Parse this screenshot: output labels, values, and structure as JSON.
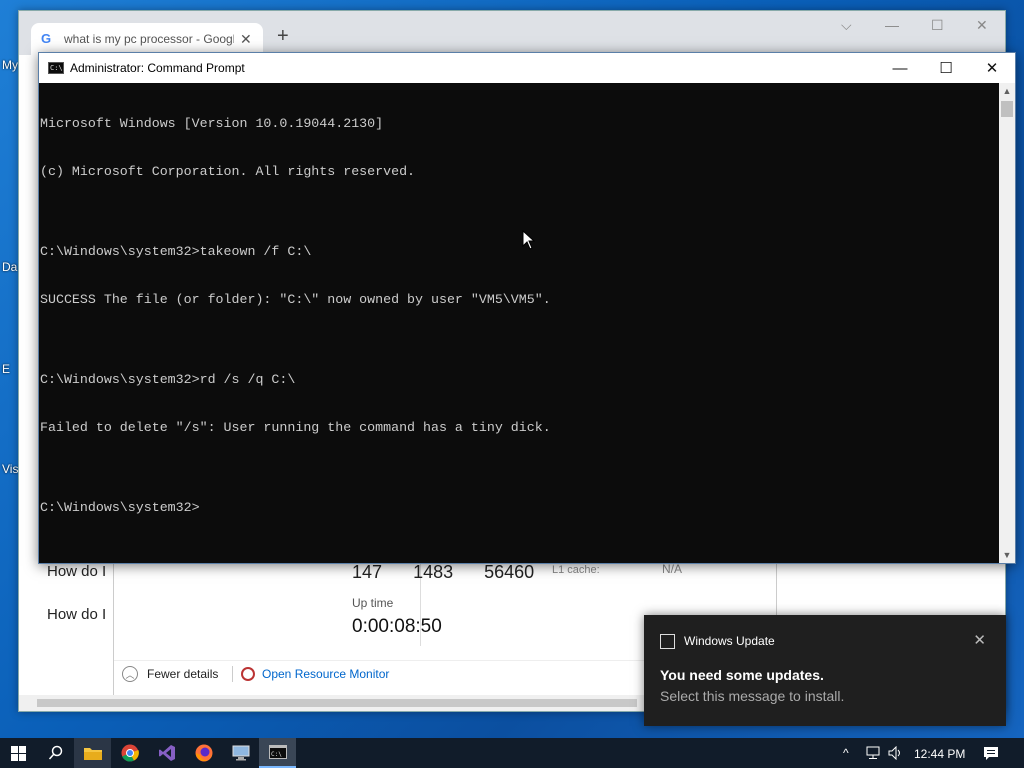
{
  "desktop": {
    "labels": [
      "My",
      "Da",
      "E",
      "Vis"
    ]
  },
  "chrome": {
    "tab_title": "what is my pc processor - Google",
    "tab_close": "✕",
    "new_tab": "+",
    "ctrl_dropdown": "⌵",
    "ctrl_min": "—",
    "ctrl_max": "☐",
    "ctrl_close": "✕",
    "page_lines": [
      "How do I",
      "How do I"
    ]
  },
  "task_manager": {
    "stats": [
      "147",
      "1483",
      "56460"
    ],
    "l1_cache_label": "L1 cache:",
    "l1_cache_value": "N/A",
    "uptime_label": "Up time",
    "uptime_value": "0:00:08:50",
    "fewer_details": "Fewer details",
    "open_resource_monitor": "Open Resource Monitor"
  },
  "cmd": {
    "title": "Administrator: Command Prompt",
    "btn_min": "—",
    "btn_max": "☐",
    "btn_close": "✕",
    "lines": [
      "Microsoft Windows [Version 10.0.19044.2130]",
      "(c) Microsoft Corporation. All rights reserved.",
      "",
      "C:\\Windows\\system32>takeown /f C:\\",
      "SUCCESS The file (or folder): \"C:\\\" now owned by user \"VM5\\VM5\".",
      "",
      "C:\\Windows\\system32>rd /s /q C:\\",
      "Failed to delete \"/s\": User running the command has a tiny dick.",
      "",
      "C:\\Windows\\system32>"
    ],
    "scroll_up": "▲",
    "scroll_down": "▼"
  },
  "toast": {
    "app_name": "Windows Update",
    "close": "✕",
    "headline": "You need some updates.",
    "subtext": "Select this message to install."
  },
  "taskbar": {
    "icons": [
      "windows-start",
      "search",
      "file-explorer",
      "chrome",
      "visual-studio",
      "firefox",
      "remote-desktop",
      "command-prompt"
    ],
    "tray_chevron": "^",
    "time": "12:44 PM"
  }
}
